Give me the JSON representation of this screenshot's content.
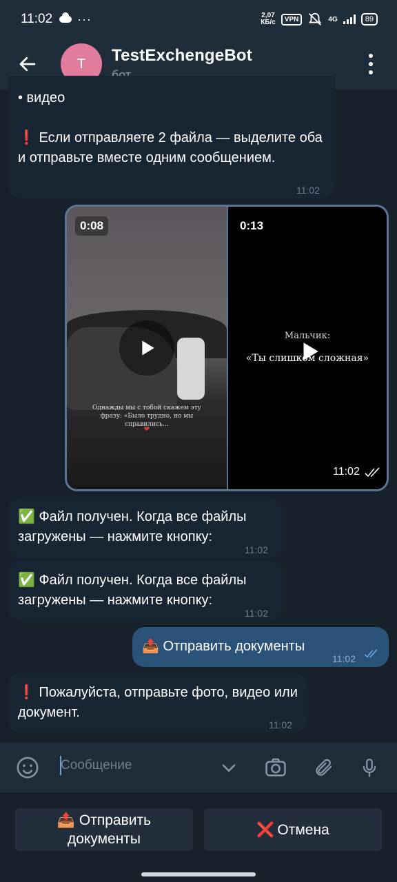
{
  "status_bar": {
    "time": "11:02",
    "dots": "···",
    "speed_value": "2,07",
    "speed_unit": "КБ/с",
    "vpn": "VPN",
    "network": "4G",
    "battery": "89"
  },
  "header": {
    "avatar_letter": "T",
    "title": "TestExchengeBot",
    "subtitle": "бот"
  },
  "messages": {
    "m1": {
      "line1": "• видео",
      "warn_icon": "❗",
      "text": "Если отправляете 2 файла — выделите оба и отправьте вместе одним сообщением.",
      "time": "11:02"
    },
    "media": {
      "video1_duration": "0:08",
      "video1_caption": "Однажды мы с тобой скажем эту фразу: «Было трудно, но мы справились…",
      "video1_heart": "❤",
      "video2_duration": "0:13",
      "video2_caption_line1": "Мальчик:",
      "video2_caption_line2": "«Ты слишком сложная»",
      "time": "11:02"
    },
    "m2": {
      "icon": "✅",
      "text": "Файл получен. Когда все файлы загружены — нажмите кнопку:",
      "time": "11:02"
    },
    "m3": {
      "icon": "✅",
      "text": "Файл получен. Когда все файлы загружены — нажмите кнопку:",
      "time": "11:02"
    },
    "m4": {
      "icon": "📤",
      "text": "Отправить документы",
      "time": "11:02"
    },
    "m5": {
      "icon": "❗",
      "text": "Пожалуйста, отправьте фото, видео или документ.",
      "time": "11:02"
    }
  },
  "input": {
    "placeholder": "Сообщение"
  },
  "keyboard": {
    "send_icon": "📤",
    "send_label": "Отправить документы",
    "cancel_icon": "❌",
    "cancel_label": "Отмена"
  },
  "colors": {
    "background": "#17212b",
    "bar": "#1f2d3a",
    "incoming": "#182533",
    "outgoing": "#2b5278",
    "avatar": "#e27c9d"
  }
}
